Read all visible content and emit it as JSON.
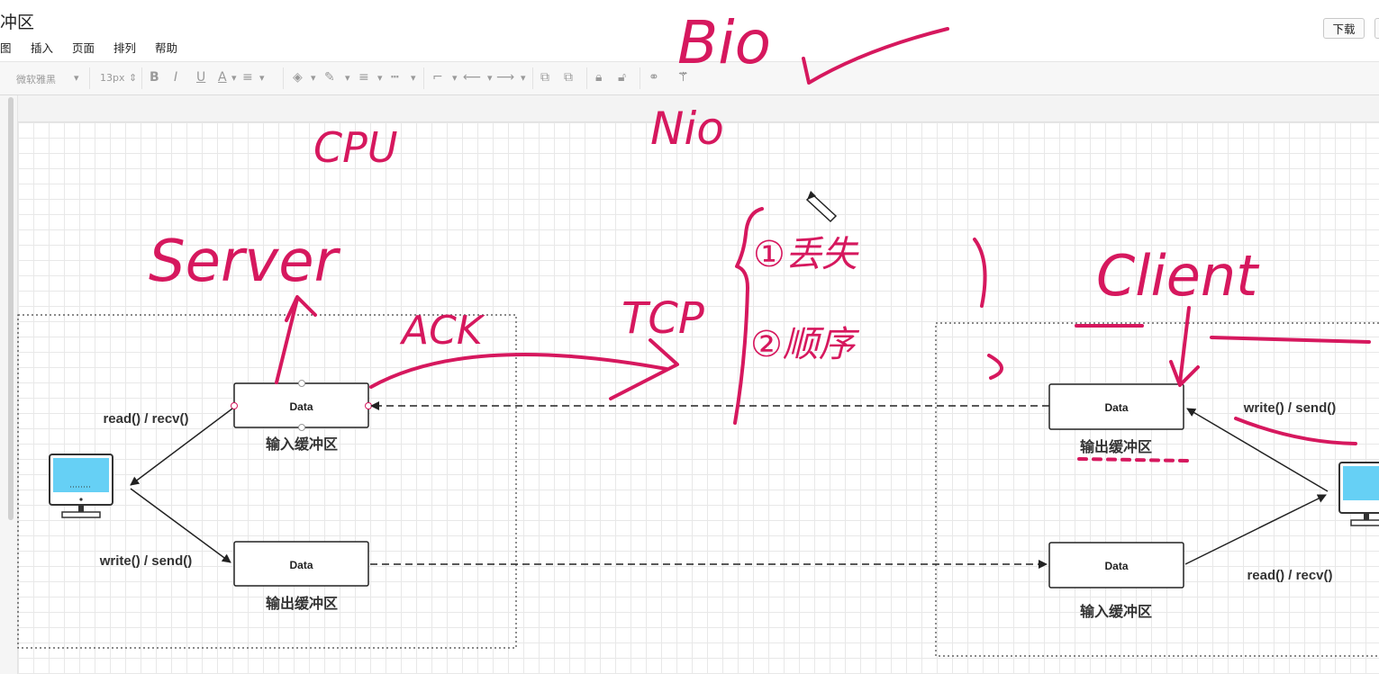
{
  "app": {
    "title": "冲区"
  },
  "menu": [
    "图",
    "插入",
    "页面",
    "排列",
    "帮助"
  ],
  "download_label": "下载",
  "toolbar": {
    "font_family": "微软雅黑",
    "font_size": "13px"
  },
  "diagram": {
    "server": {
      "in_box": "Data",
      "in_caption": "输入缓冲区",
      "out_box": "Data",
      "out_caption": "输出缓冲区",
      "read_label": "read() / recv()",
      "write_label": "write() / send()"
    },
    "client": {
      "out_box": "Data",
      "out_caption": "输出缓冲区",
      "in_box": "Data",
      "in_caption": "输入缓冲区",
      "write_label": "write() / send()",
      "read_label": "read() / recv()"
    }
  },
  "annotations": {
    "bio": "Bio",
    "nio": "Nio",
    "cpu": "CPU",
    "server": "Server",
    "client": "Client",
    "ack": "ACK",
    "tcp": "TCP",
    "item1": "①丢失",
    "item2": "②顺序"
  },
  "colors": {
    "ink": "#d6185e",
    "accent": "#66d0f5"
  }
}
